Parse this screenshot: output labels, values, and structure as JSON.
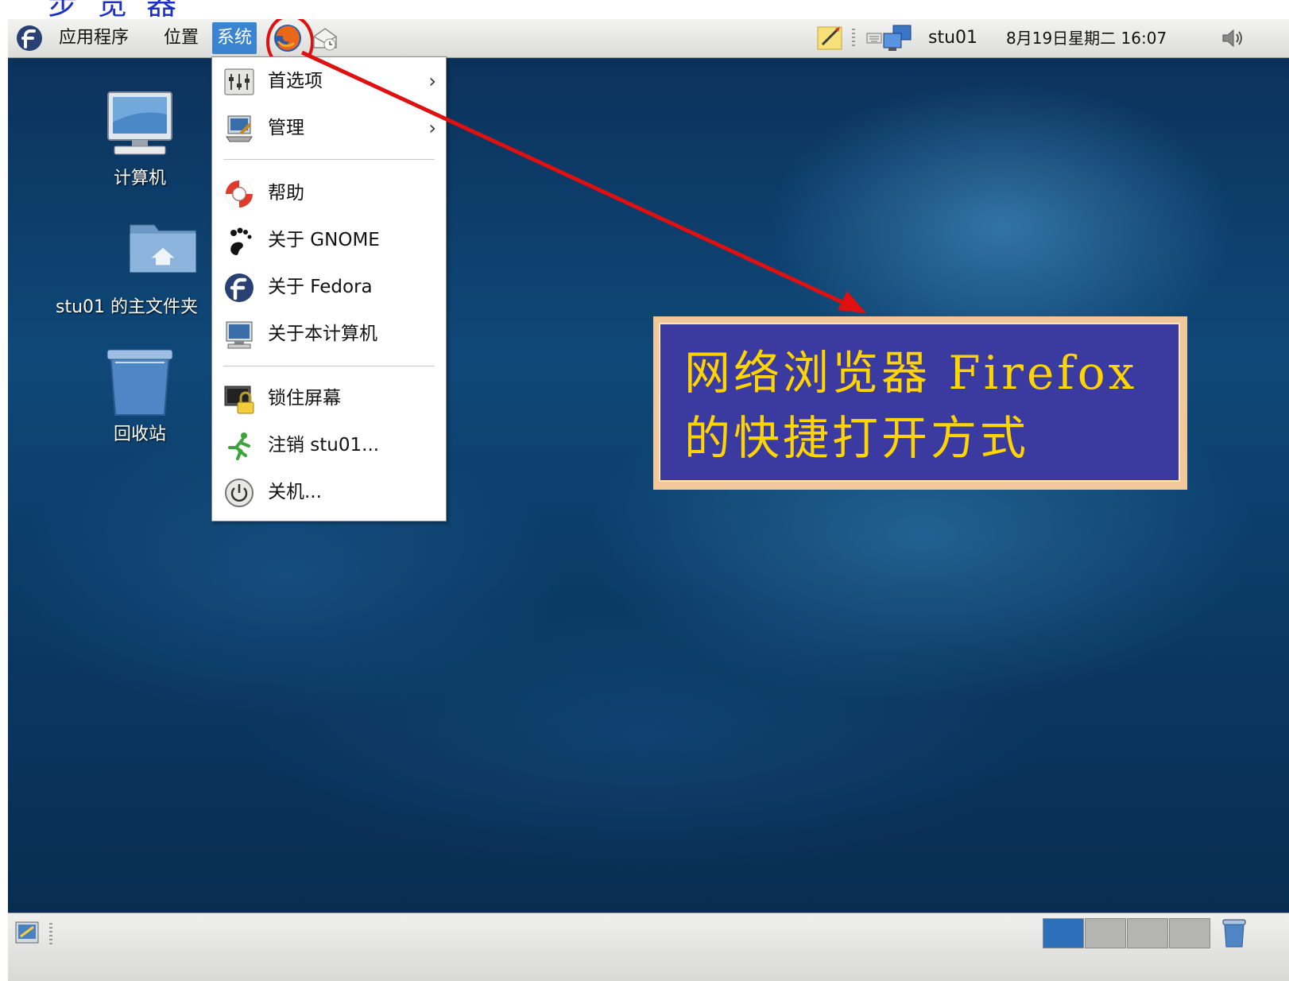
{
  "slide": {
    "heading_fragment": "步 览 器"
  },
  "top_panel": {
    "applications": "应用程序",
    "places": "位置",
    "system": "系统",
    "username": "stu01",
    "clock": "8月19日星期二 16:07"
  },
  "system_menu": {
    "items": [
      {
        "label": "首选项",
        "icon": "preferences-icon",
        "submenu": true
      },
      {
        "label": "管理",
        "icon": "administration-icon",
        "submenu": true
      },
      {
        "label": "帮助",
        "icon": "help-lifebuoy-icon"
      },
      {
        "label": "关于 GNOME",
        "icon": "gnome-foot-icon"
      },
      {
        "label": "关于 Fedora",
        "icon": "fedora-icon"
      },
      {
        "label": "关于本计算机",
        "icon": "monitor-icon"
      },
      {
        "label": "锁住屏幕",
        "icon": "lock-screen-icon"
      },
      {
        "label": "注销 stu01...",
        "icon": "logout-running-man-icon"
      },
      {
        "label": "关机...",
        "icon": "power-icon"
      }
    ]
  },
  "desktop_icons": [
    {
      "label": "计算机",
      "icon": "computer-icon"
    },
    {
      "label": "stu01 的主文件夹",
      "icon": "home-folder-icon"
    },
    {
      "label": "回收站",
      "icon": "trash-icon"
    }
  ],
  "annotation": {
    "line1": "网络浏览器 Firefox",
    "line2": "的快捷打开方式",
    "text_color": "#ffd400",
    "box_color": "#3a3aa0",
    "arrow_color": "#e01010"
  }
}
